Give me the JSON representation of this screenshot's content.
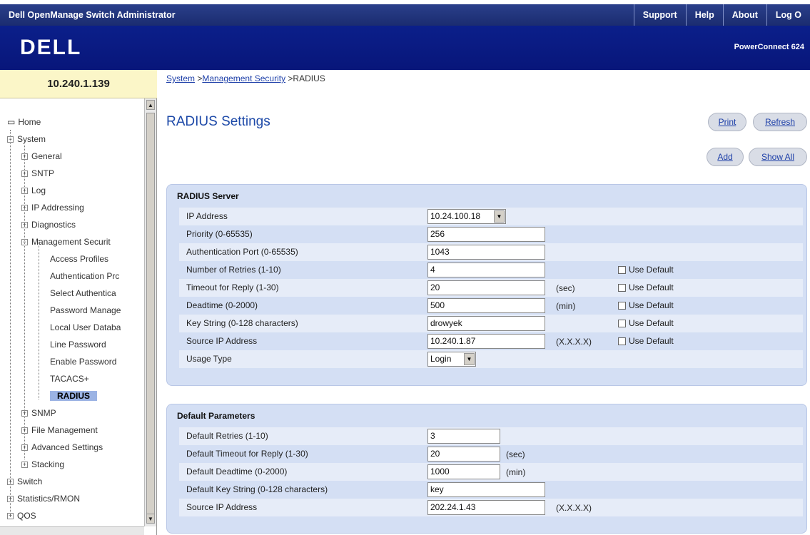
{
  "topbar": {
    "title": "Dell OpenManage Switch Administrator",
    "links": [
      "Support",
      "Help",
      "About",
      "Log O"
    ]
  },
  "brand": {
    "logo": "DELL",
    "product": "PowerConnect 624"
  },
  "sidebar": {
    "ip": "10.240.1.139",
    "tree": [
      {
        "label": "Home",
        "type": "home"
      },
      {
        "label": "System",
        "type": "minus"
      },
      {
        "label": "General",
        "type": "plus"
      },
      {
        "label": "SNTP",
        "type": "plus"
      },
      {
        "label": "Log",
        "type": "plus"
      },
      {
        "label": "IP Addressing",
        "type": "plus"
      },
      {
        "label": "Diagnostics",
        "type": "plus"
      },
      {
        "label": "Management Securit",
        "type": "minus"
      },
      {
        "label": "Access Profiles",
        "type": "leaf"
      },
      {
        "label": "Authentication Prc",
        "type": "leaf"
      },
      {
        "label": "Select Authentica",
        "type": "leaf"
      },
      {
        "label": "Password Manage",
        "type": "leaf"
      },
      {
        "label": "Local User Databa",
        "type": "leaf"
      },
      {
        "label": "Line Password",
        "type": "leaf"
      },
      {
        "label": "Enable Password",
        "type": "leaf"
      },
      {
        "label": "TACACS+",
        "type": "leaf"
      },
      {
        "label": "RADIUS",
        "type": "selected"
      },
      {
        "label": "SNMP",
        "type": "plus"
      },
      {
        "label": "File Management",
        "type": "plus"
      },
      {
        "label": "Advanced Settings",
        "type": "plus"
      },
      {
        "label": "Stacking",
        "type": "plus"
      },
      {
        "label": "Switch",
        "type": "plus"
      },
      {
        "label": "Statistics/RMON",
        "type": "plus"
      },
      {
        "label": "QOS",
        "type": "plus"
      }
    ]
  },
  "breadcrumb": {
    "part1": "System",
    "sep1": " >",
    "part2": "Management Security",
    "sep2": " >RADIUS"
  },
  "page_title": "RADIUS Settings",
  "buttons": {
    "print": "Print",
    "refresh": "Refresh",
    "add": "Add",
    "show_all": "Show All"
  },
  "radius_server": {
    "title": "RADIUS Server",
    "rows": [
      {
        "label": "IP Address",
        "value": "10.24.100.18",
        "kind": "select"
      },
      {
        "label": "Priority (0-65535)",
        "value": "256",
        "kind": "input"
      },
      {
        "label": "Authentication Port (0-65535)",
        "value": "1043",
        "kind": "input"
      },
      {
        "label": "Number of Retries (1-10)",
        "value": "4",
        "kind": "input",
        "default": "Use Default"
      },
      {
        "label": "Timeout for Reply (1-30)",
        "value": "20",
        "kind": "input",
        "unit": "(sec)",
        "default": "Use Default"
      },
      {
        "label": "Deadtime (0-2000)",
        "value": "500",
        "kind": "input",
        "unit": "(min)",
        "default": "Use Default"
      },
      {
        "label": "Key String (0-128 characters)",
        "value": "drowyek",
        "kind": "input",
        "default": "Use Default"
      },
      {
        "label": "Source IP Address",
        "value": "10.240.1.87",
        "kind": "input",
        "unit": "(X.X.X.X)",
        "default": "Use Default"
      },
      {
        "label": "Usage Type",
        "value": "Login",
        "kind": "select"
      }
    ]
  },
  "default_params": {
    "title": "Default Parameters",
    "rows": [
      {
        "label": "Default Retries (1-10)",
        "value": "3",
        "kind": "input"
      },
      {
        "label": "Default Timeout for Reply (1-30)",
        "value": "20",
        "kind": "input",
        "unit": "(sec)"
      },
      {
        "label": "Default Deadtime (0-2000)",
        "value": "1000",
        "kind": "input",
        "unit": "(min)"
      },
      {
        "label": "Default Key String (0-128 characters)",
        "value": "key",
        "kind": "input"
      },
      {
        "label": "Source IP Address",
        "value": "202.24.1.43",
        "kind": "input",
        "unit": "(X.X.X.X)"
      }
    ]
  }
}
